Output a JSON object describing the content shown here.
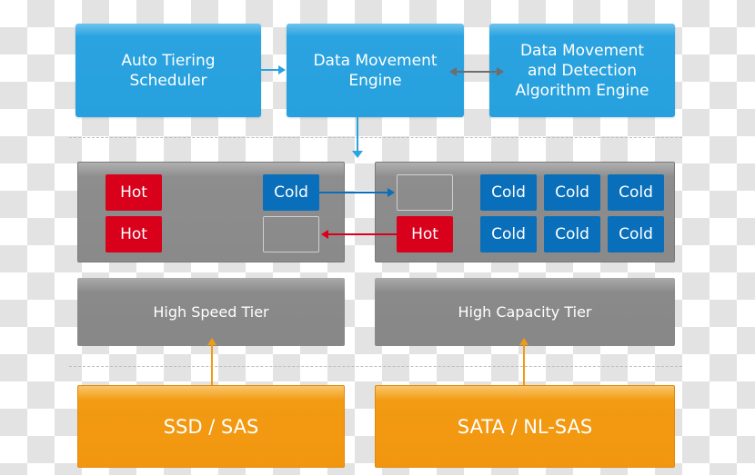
{
  "colors": {
    "engine_blue": "#2aa3e0",
    "cold_blue": "#0a6fba",
    "hot_red": "#d9001b",
    "tier_gray": "#8a8a8a",
    "storage_orange": "#f29a12",
    "arrow_gray": "#6d6d6d"
  },
  "engines": {
    "scheduler": "Auto Tiering\nScheduler",
    "movement": "Data Movement\nEngine",
    "detection": "Data Movement\nand Detection\nAlgorithm Engine"
  },
  "left_pool": {
    "row1": [
      "Hot",
      "",
      "Cold"
    ],
    "row2": [
      "Hot",
      "",
      ""
    ]
  },
  "right_pool": {
    "row1": [
      "",
      "Cold",
      "Cold",
      "Cold"
    ],
    "row2": [
      "Hot",
      "Cold",
      "Cold",
      "Cold"
    ]
  },
  "tiers": {
    "high_speed": "High Speed Tier",
    "high_capacity": "High Capacity Tier"
  },
  "storage": {
    "fast": "SSD / SAS",
    "capacity": "SATA / NL-SAS"
  }
}
